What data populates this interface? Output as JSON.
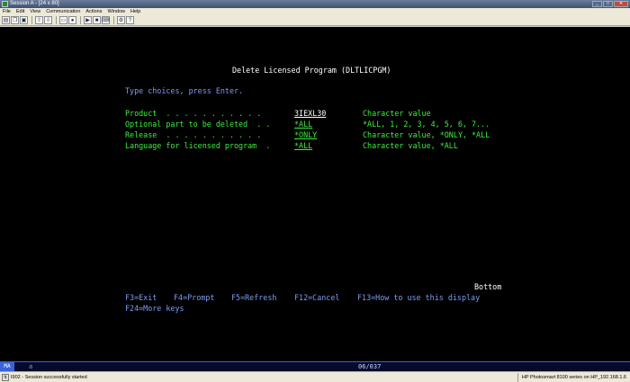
{
  "window": {
    "title": "Session A - [24 x 80]"
  },
  "menu": [
    "File",
    "Edit",
    "View",
    "Communication",
    "Actions",
    "Window",
    "Help"
  ],
  "toolbar_icons": [
    "print-icon",
    "copy-icon",
    "paste-icon",
    "send-icon",
    "receive-icon",
    "display-icon",
    "macro-record-icon",
    "macro-play-icon",
    "macro-stop-icon",
    "keypad-icon",
    "settings-icon",
    "help-icon"
  ],
  "screen": {
    "title": "Delete Licensed Program (DLTLICPGM)",
    "instruction": "Type choices, press Enter.",
    "fields": [
      {
        "label": "Product  . . . . . . . . . . .",
        "value": "3IEXL30",
        "hint": "Character value"
      },
      {
        "label": "Optional part to be deleted  . .",
        "value": "*ALL",
        "hint": "*ALL, 1, 2, 3, 4, 5, 6, 7..."
      },
      {
        "label": "Release  . . . . . . . . . . .",
        "value": "*ONLY",
        "hint": "Character value, *ONLY, *ALL"
      },
      {
        "label": "Language for licensed program  .",
        "value": "*ALL",
        "hint": "Character value, *ALL"
      }
    ],
    "bottom": "Bottom",
    "fkeys_line1": [
      "F3=Exit",
      "F4=Prompt",
      "F5=Refresh",
      "F12=Cancel",
      "F13=How to use this display"
    ],
    "fkeys_line2": [
      "F24=More keys"
    ]
  },
  "oia": {
    "mode": "MA",
    "indicator": "a",
    "cursor": "06/037"
  },
  "status": {
    "message": "I902 - Session successfully started",
    "printer": "HP Photosmart 8100 series on HP_192.168.1.6"
  },
  "colors": {
    "screen_bg": "#000000",
    "title": "#ffffff",
    "instruction": "#7e9bf5",
    "field": "#3cf03c"
  }
}
